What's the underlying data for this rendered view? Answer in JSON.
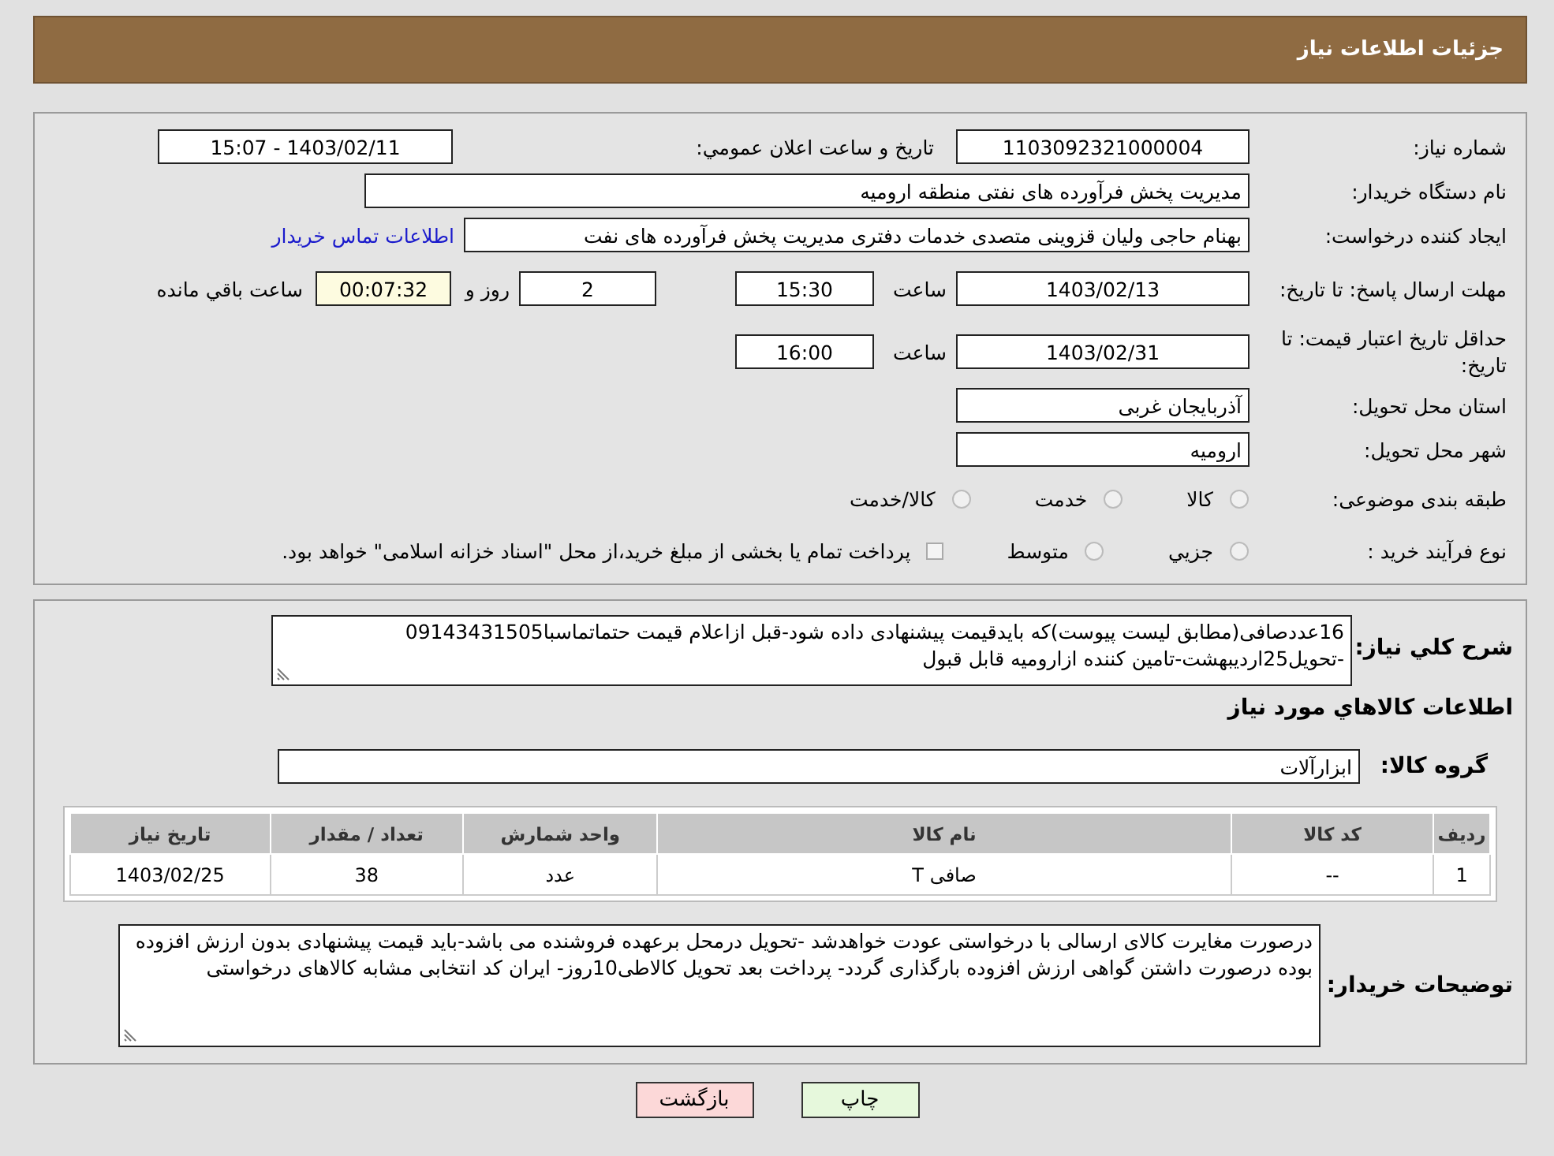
{
  "header": {
    "title": "جزئیات اطلاعات نیاز"
  },
  "details": {
    "need_number": {
      "label": "شماره نیاز:",
      "value": "1103092321000004"
    },
    "announce": {
      "label": "تاریخ و ساعت اعلان عمومي:",
      "value": "1403/02/11 - 15:07"
    },
    "buyer": {
      "label": "نام دستگاه خریدار:",
      "value": "مدیریت پخش فرآورده های نفتی منطقه ارومیه"
    },
    "creator": {
      "label": "ایجاد کننده درخواست:",
      "value": "بهنام حاجی ولیان قزوینی متصدی خدمات دفتری مدیریت پخش فرآورده های نفت",
      "link": "اطلاعات تماس خریدار"
    },
    "reply_deadline": {
      "label": "مهلت ارسال پاسخ: تا تاریخ:",
      "date": "1403/02/13",
      "time_label": "ساعت",
      "time": "15:30",
      "days": "2",
      "days_label": "روز و",
      "remaining": "00:07:32",
      "remaining_label": "ساعت باقي مانده"
    },
    "price_validity": {
      "label": "حداقل تاریخ اعتبار قیمت: تا تاریخ:",
      "date": "1403/02/31",
      "time_label": "ساعت",
      "time": "16:00"
    },
    "province": {
      "label": "استان محل تحویل:",
      "value": "آذربایجان غربی"
    },
    "city": {
      "label": "شهر محل تحویل:",
      "value": "ارومیه"
    },
    "category": {
      "label": "طبقه بندی موضوعی:",
      "options": [
        {
          "label": "کالا",
          "selected": false
        },
        {
          "label": "خدمت",
          "selected": false
        },
        {
          "label": "کالا/خدمت",
          "selected": false
        }
      ]
    },
    "process": {
      "label": "نوع فرآیند خرید :",
      "options": [
        {
          "label": "جزيي",
          "selected": false
        },
        {
          "label": "متوسط",
          "selected": false
        }
      ],
      "payment_note": {
        "checked": false,
        "text": "پرداخت تمام یا بخشی از مبلغ خرید،از محل \"اسناد خزانه اسلامی\" خواهد بود."
      }
    }
  },
  "need": {
    "description": {
      "label": "شرح كلي نیاز:",
      "value": "16عددصافی(مطابق لیست پیوست)که بایدقیمت پیشنهادی داده شود-قبل ازاعلام قیمت حتماتماسبا09143431505 -تحویل25اردیبهشت-تامین کننده ازارومیه قابل قبول"
    },
    "goods_heading": "اطلاعات كالاهاي مورد نیاز",
    "group": {
      "label": "گروه كالا:",
      "value": "ابزارآلات"
    },
    "table": {
      "columns": [
        "ردیف",
        "کد کالا",
        "نام کالا",
        "واحد شمارش",
        "تعداد / مقدار",
        "تاریخ نیاز"
      ],
      "rows": [
        [
          "1",
          "--",
          "صافی T",
          "عدد",
          "38",
          "1403/02/25"
        ]
      ]
    },
    "buyer_notes": {
      "label": "توضیحات خریدار:",
      "value": "درصورت مغایرت کالای ارسالی با درخواستی عودت خواهدشد -تحویل درمحل برعهده فروشنده می باشد-باید قیمت پیشنهادی بدون ارزش افزوده بوده درصورت داشتن گواهی ارزش افزوده بارگذاری گردد- پرداخت بعد تحویل کالاطی10روز- ایران کد انتخابی مشابه کالاهای درخواستی"
    }
  },
  "buttons": [
    {
      "label": "چاپ",
      "kind": "print"
    },
    {
      "label": "بازگشت",
      "kind": "back"
    }
  ]
}
